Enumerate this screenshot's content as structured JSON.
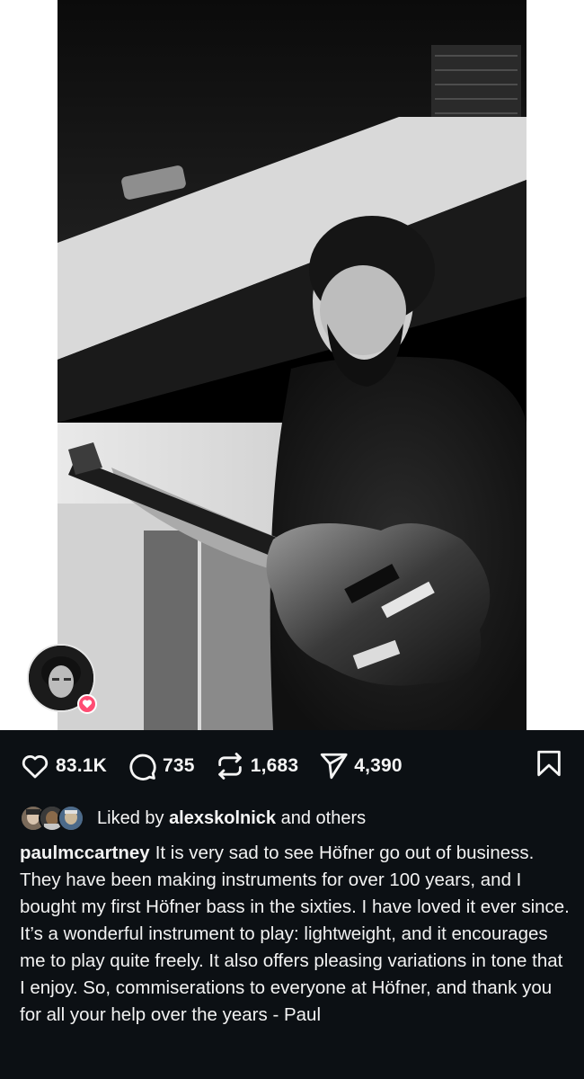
{
  "post": {
    "likes_count": "83.1K",
    "comments_count": "735",
    "reposts_count": "1,683",
    "shares_count": "4,390"
  },
  "likes_line": {
    "prefix": "Liked by",
    "liker": "alexskolnick",
    "suffix": "and others"
  },
  "caption": {
    "username": "paulmccartney",
    "text": "It is very sad to see Höfner go out of business. They have been making instruments for over 100 years, and I bought my first Höfner bass in the sixties. I have loved it ever since. It’s a wonderful instrument to play: lightweight, and it encourages me to play quite freely. It also offers pleasing variations in tone that I enjoy. So, commiserations to everyone at Höfner, and thank you for all your help over the years - Paul"
  },
  "icons": {
    "like": "heart-icon",
    "comment": "comment-icon",
    "repost": "repost-icon",
    "share": "send-icon",
    "save": "bookmark-icon"
  },
  "colors": {
    "background": "#0c1014",
    "text": "#f5f5f5",
    "story_heart": "#ff4d73"
  }
}
